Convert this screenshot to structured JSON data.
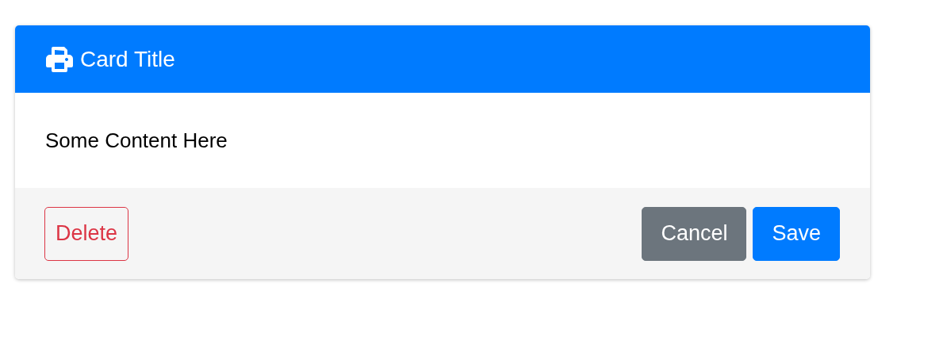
{
  "card": {
    "title": "Card Title",
    "content": "Some Content Here",
    "footer": {
      "start_buttons": [
        {
          "label": "Delete",
          "kind": "outline-danger"
        }
      ],
      "end_buttons": [
        {
          "label": "Cancel",
          "kind": "secondary"
        },
        {
          "label": "Save",
          "kind": "primary"
        }
      ]
    }
  }
}
